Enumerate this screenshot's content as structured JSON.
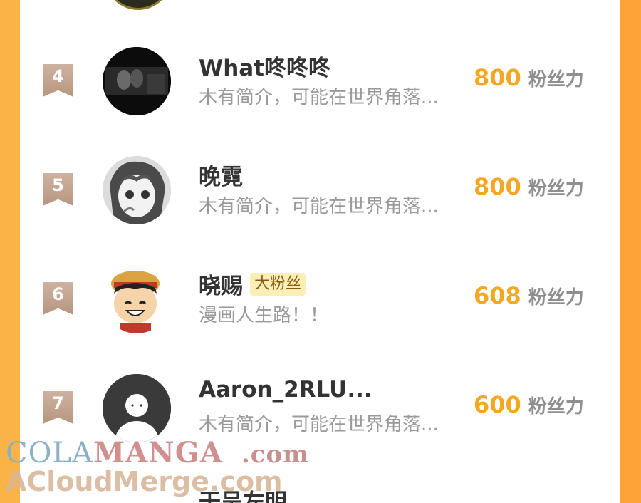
{
  "ranking": [
    {
      "rank": "4",
      "name": "What咚咚咚",
      "badge": "",
      "intro": "木有简介，可能在世界角落...",
      "score": "800",
      "unit": "粉丝力"
    },
    {
      "rank": "5",
      "name": "晚霓",
      "badge": "",
      "intro": "木有简介，可能在世界角落...",
      "score": "800",
      "unit": "粉丝力"
    },
    {
      "rank": "6",
      "name": "晓赐",
      "badge": "大粉丝",
      "intro": "漫画人生路！！",
      "score": "608",
      "unit": "粉丝力"
    },
    {
      "rank": "7",
      "name": "Aaron_2RLU...",
      "badge": "",
      "intro": "木有简介，可能在世界角落...",
      "score": "600",
      "unit": "粉丝力"
    }
  ],
  "next_partial_name": "干呈左明",
  "watermark": {
    "line1_a": "COLA",
    "line1_b": "MANGA",
    "line1_c": ".com",
    "line2": "ACloudMerge.com"
  }
}
